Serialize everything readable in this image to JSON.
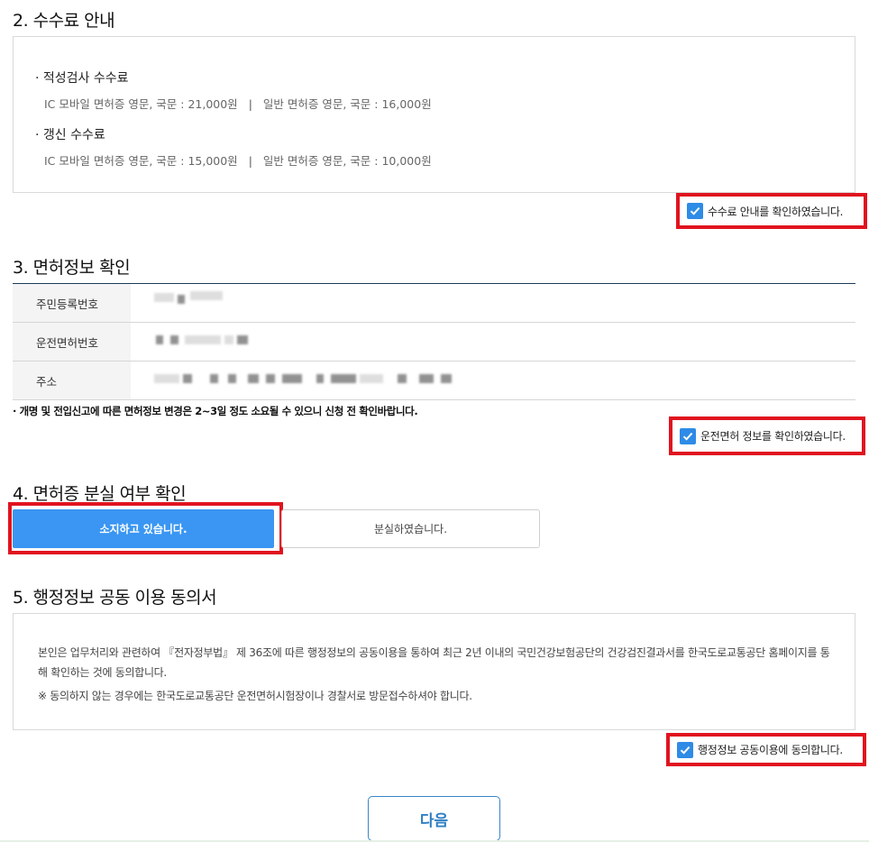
{
  "fee_section": {
    "heading": "2. 수수료 안내",
    "aptitude_title": "· 적성검사 수수료",
    "aptitude_ic": "IC 모바일 면허증 영문, 국문 : 21,000원",
    "aptitude_general": "일반 면허증 영문, 국문 : 16,000원",
    "renewal_title": "· 갱신 수수료",
    "renewal_ic": "IC 모바일 면허증 영문, 국문 : 15,000원",
    "renewal_general": "일반 면허증 영문, 국문 : 10,000원",
    "separator": "|",
    "confirm_label": "수수료 안내를 확인하였습니다.",
    "confirm_checked": true
  },
  "license_section": {
    "heading": "3. 면허정보 확인",
    "rows": [
      {
        "label": "주민등록번호"
      },
      {
        "label": "운전면허번호"
      },
      {
        "label": "주소"
      }
    ],
    "notice": "· 개명 및 전입신고에 따른 면허정보 변경은 2~3일 정도 소요될 수 있으니 신청 전 확인바랍니다.",
    "confirm_label": "운전면허 정보를 확인하였습니다.",
    "confirm_checked": true
  },
  "loss_section": {
    "heading": "4. 면허증 분실 여부 확인",
    "option_have": "소지하고 있습니다.",
    "option_lost": "분실하였습니다.",
    "selected": "소지하고 있습니다."
  },
  "consent_section": {
    "heading": "5. 행정정보 공동 이용 동의서",
    "body": "본인은 업무처리와 관련하여 『전자정부법』 제 36조에 따른 행정정보의 공동이용을 통하여 최근 2년 이내의 국민건강보험공단의 건강검진결과서를 한국도로교통공단 홈페이지를 통해 확인하는 것에 동의합니다.",
    "note": "※ 동의하지 않는 경우에는 한국도로교통공단 운전면허시험장이나 경찰서로 방문접수하셔야 합니다.",
    "confirm_label": "행정정보 공동이용에 동의합니다.",
    "confirm_checked": true
  },
  "next_button": "다음",
  "colors": {
    "accent": "#3a96f2",
    "highlight": "#e0141f",
    "checkbox": "#2e8be6",
    "table_top_rule": "#1d3b5c"
  }
}
